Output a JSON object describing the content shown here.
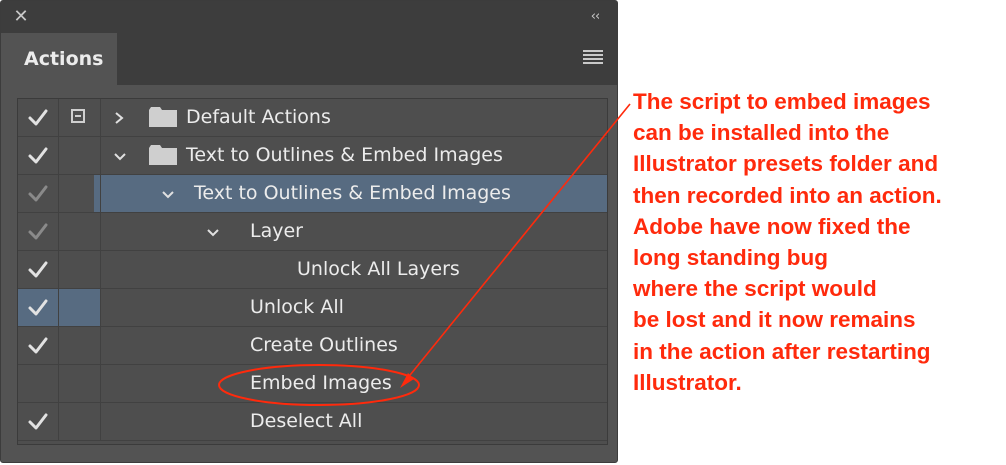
{
  "window": {
    "close_icon": "close-icon",
    "collapse_icon": "collapse-double-chevron-icon",
    "collapse_glyph": "‹‹"
  },
  "tabs": [
    {
      "label": "Actions",
      "active": true
    }
  ],
  "panel_menu_icon": "hamburger-menu-icon",
  "rows": [
    {
      "label": "Default Actions",
      "check": "enabled",
      "dialog": true,
      "toggle": "collapsed",
      "folder": true
    },
    {
      "label": "Text to Outlines & Embed Images",
      "check": "enabled",
      "dialog": false,
      "toggle": "expanded",
      "folder": true
    },
    {
      "label": "Text to Outlines & Embed Images",
      "check": "dimmed",
      "dialog": false,
      "toggle": "expanded",
      "folder": false,
      "selected": true
    },
    {
      "label": "Layer",
      "check": "dimmed",
      "dialog": false,
      "toggle": "expanded",
      "folder": false
    },
    {
      "label": "Unlock All Layers",
      "check": "enabled",
      "dialog": false,
      "toggle": null,
      "folder": false
    },
    {
      "label": "Unlock All",
      "check": "enabled",
      "dialog": false,
      "toggle": null,
      "folder": false,
      "highlight_cells": true
    },
    {
      "label": "Create Outlines",
      "check": "enabled",
      "dialog": false,
      "toggle": null,
      "folder": false
    },
    {
      "label": "Embed Images",
      "check": "none",
      "dialog": false,
      "toggle": null,
      "folder": false,
      "circled": true
    },
    {
      "label": "Deselect All",
      "check": "enabled",
      "dialog": false,
      "toggle": null,
      "folder": false
    }
  ],
  "annotation": {
    "color": "#ff2a0c",
    "lines": [
      "The script to embed images",
      "can be installed into the",
      "Illustrator presets folder and",
      "then recorded into an action.",
      "Adobe have now fixed the",
      "long standing bug",
      "where the script would",
      "be lost and it now remains",
      "in the action after restarting",
      "Illustrator."
    ]
  },
  "colors": {
    "panel_bg": "#535353",
    "header_bg": "#3d3d3d",
    "selection": "#576b81",
    "text": "#ececec"
  }
}
